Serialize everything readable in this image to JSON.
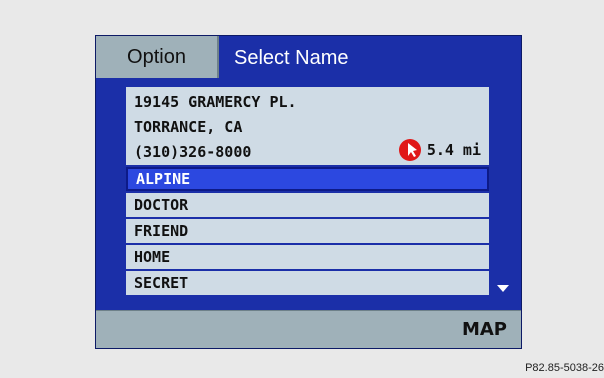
{
  "header": {
    "option_label": "Option",
    "title": "Select Name"
  },
  "address": {
    "street": "19145 GRAMERCY PL.",
    "city_state": "TORRANCE, CA",
    "phone": "(310)326-8000",
    "direction_icon": "direction-arrow-icon",
    "distance": "5.4 mi"
  },
  "names": [
    {
      "label": "ALPINE",
      "selected": true
    },
    {
      "label": "DOCTOR",
      "selected": false
    },
    {
      "label": "FRIEND",
      "selected": false
    },
    {
      "label": "HOME",
      "selected": false
    },
    {
      "label": "SECRET",
      "selected": false
    }
  ],
  "footer": {
    "map_label": "MAP"
  },
  "reference_code": "P82.85-5038-26",
  "colors": {
    "screen_background": "#1b2fa8",
    "panel": "#9fb1b9",
    "list_item": "#cfdbe5",
    "selected_item": "#2c48e0",
    "direction_icon": "#e01818"
  }
}
